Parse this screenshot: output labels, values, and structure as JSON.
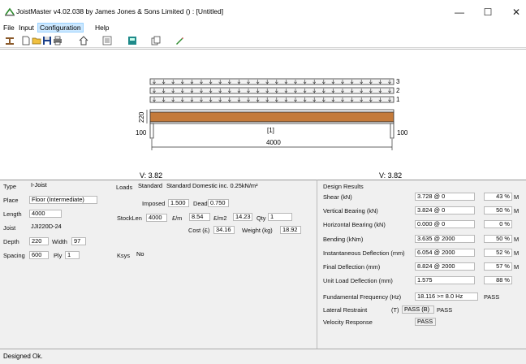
{
  "window": {
    "title": "JoistMaster v4.02.038 by James Jones & Sons Limited () : [Untitled]",
    "minimize": "—",
    "maximize": "☐",
    "close": "✕"
  },
  "menu": [
    "File",
    "Input",
    "Configuration",
    "Help"
  ],
  "toolbar_icons": [
    "joist-icon",
    "new-file-icon",
    "open-folder-icon",
    "save-icon",
    "print-icon",
    "home-icon",
    "list-icon",
    "calculator-icon",
    "copy-icon",
    "pencil-icon"
  ],
  "drawing": {
    "layers": [
      "3",
      "2",
      "1"
    ],
    "depth_label": "220",
    "span_label": "4000",
    "bearing_left": "100",
    "bearing_right": "100",
    "joist_tag": "[1]",
    "reaction_left": "V: 3.82",
    "reaction_right": "V: 3.82",
    "colors": {
      "joist": "#c47a3a",
      "load_band": "#f2f2f2"
    }
  },
  "inputs": {
    "type_label": "Type",
    "type_value": "I-Joist",
    "place_label": "Place",
    "place_value": "Floor (Intermediate)",
    "length_label": "Length",
    "length_value": "4000",
    "joist_label": "Joist",
    "joist_value": "JJI220D-24",
    "depth_label": "Depth",
    "depth_value": "220",
    "width_label": "Width",
    "width_value": "97",
    "spacing_label": "Spacing",
    "spacing_value": "600",
    "ply_label": "Ply",
    "ply_value": "1",
    "loads_label": "Loads",
    "loads_value": "Standard",
    "loads_desc": "Standard Domestic inc. 0.25kN/m²",
    "imposed_label": "Imposed",
    "imposed_value": "1.500",
    "dead_label": "Dead",
    "dead_value": "0.750",
    "stocklen_label": "StockLen",
    "stocklen_value": "4000",
    "em_label": "£/m",
    "em_value": "8.54",
    "em2_label": "£/m2",
    "em2_value": "14.23",
    "qty_label": "Qty",
    "qty_value": "1",
    "cost_label": "Cost (£)",
    "cost_value": "34.16",
    "weight_label": "Weight (kg)",
    "weight_value": "18.92",
    "ksys_label": "Ksys",
    "ksys_value": "No"
  },
  "results": {
    "heading": "Design Results",
    "rows": [
      {
        "label": "Shear (kN)",
        "value": "3.728 @ 0",
        "util": "43 %",
        "flag": "M"
      },
      {
        "label": "Vertical Bearing (kN)",
        "value": "3.824 @ 0",
        "util": "50 %",
        "flag": "M"
      },
      {
        "label": "Horizontal Bearing (kN)",
        "value": "0.000 @ 0",
        "util": "0 %",
        "flag": ""
      },
      {
        "label": "Bending (kNm)",
        "value": "3.635 @ 2000",
        "util": "50 %",
        "flag": "M"
      },
      {
        "label": "Instantaneous Deflection (mm)",
        "value": "6.054 @ 2000",
        "util": "52 %",
        "flag": "M"
      },
      {
        "label": "Final Deflection (mm)",
        "value": "8.824 @ 2000",
        "util": "57 %",
        "flag": "M"
      },
      {
        "label": "Unit Load Deflection (mm)",
        "value": "1.575",
        "util": "88 %",
        "flag": ""
      }
    ],
    "freq_label": "Fundamental Frequency (Hz)",
    "freq_value": "18.116 >= 8.0 Hz",
    "freq_result": "PASS",
    "lateral_label": "Lateral Restraint",
    "lateral_t": "(T)",
    "lateral_value": "PASS (B)",
    "lateral_result": "PASS",
    "velocity_label": "Velocity Response",
    "velocity_result": "PASS"
  },
  "status": {
    "text": "Designed Ok."
  }
}
